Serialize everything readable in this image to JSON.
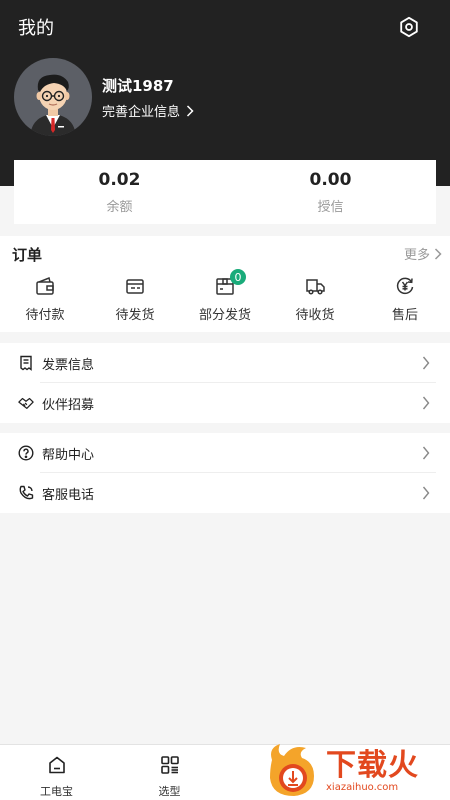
{
  "header": {
    "title": "我的"
  },
  "profile": {
    "name": "测试1987",
    "company_link": "完善企业信息"
  },
  "balance": {
    "items": [
      {
        "value": "0.02",
        "label": "余额"
      },
      {
        "value": "0.00",
        "label": "授信"
      }
    ]
  },
  "orders": {
    "title": "订单",
    "more": "更多",
    "items": [
      {
        "label": "待付款",
        "icon": "wallet-icon"
      },
      {
        "label": "待发货",
        "icon": "pending-shipment-icon"
      },
      {
        "label": "部分发货",
        "icon": "package-box-icon",
        "badge": "0"
      },
      {
        "label": "待收货",
        "icon": "delivery-truck-icon"
      },
      {
        "label": "售后",
        "icon": "yen-refund-icon"
      }
    ]
  },
  "menu1": [
    {
      "label": "发票信息",
      "icon": "invoice-icon"
    },
    {
      "label": "伙伴招募",
      "icon": "handshake-icon"
    }
  ],
  "menu2": [
    {
      "label": "帮助中心",
      "icon": "help-icon"
    },
    {
      "label": "客服电话",
      "icon": "phone-icon"
    }
  ],
  "tabbar": [
    {
      "label": "工电宝",
      "icon": "home-icon"
    },
    {
      "label": "选型",
      "icon": "grid-icon"
    }
  ],
  "watermark": {
    "text": "下载火",
    "sub": "xiazaihuo.com"
  }
}
